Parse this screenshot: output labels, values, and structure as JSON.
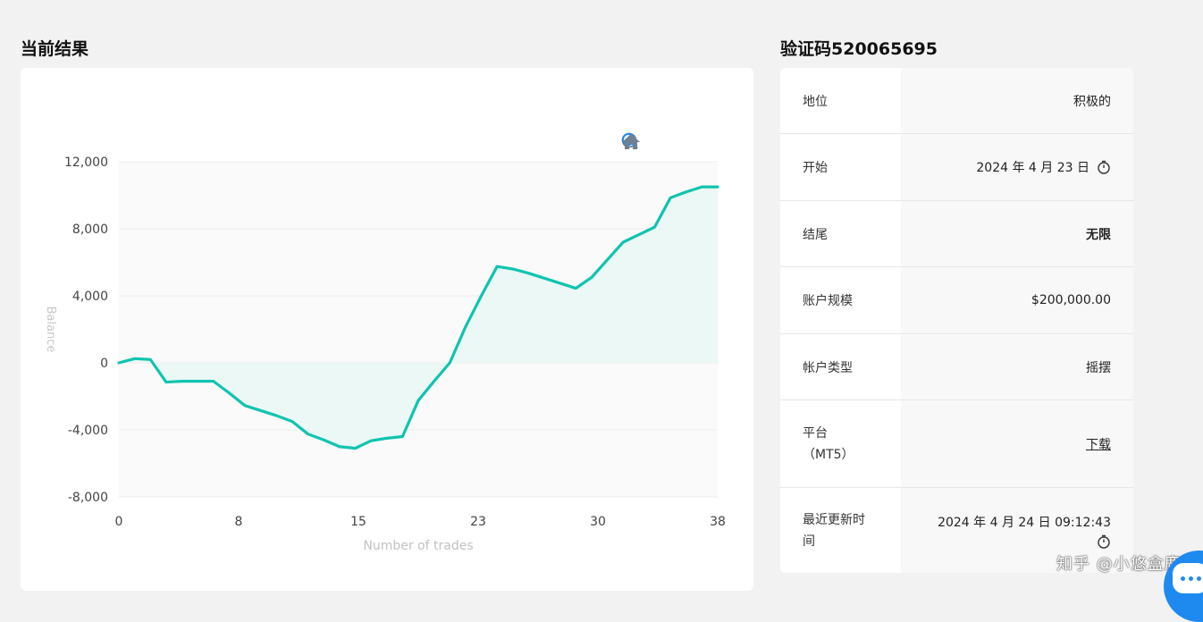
{
  "left_title": "当前结果",
  "right_title": "验证码520065695",
  "toolbar": {
    "zoom_in": "zoom-in-icon",
    "zoom_out": "zoom-out-icon",
    "zoom_select": "magnifier-zoom-icon",
    "reset": "home-icon"
  },
  "colors": {
    "line": "#10c4b0",
    "area": "#e9f7f4",
    "accent_blue": "#1e8af0",
    "toolbar_active": "#1e8af0",
    "toolbar_grey": "#6e8192"
  },
  "chart_data": {
    "type": "area",
    "xlabel": "Number of trades",
    "ylabel": "Balance",
    "xlim": [
      0,
      38
    ],
    "ylim": [
      -8000,
      12000
    ],
    "x_ticks": [
      "0",
      "8",
      "15",
      "23",
      "30",
      "38"
    ],
    "x_tick_values": [
      0,
      7.6,
      15.2,
      22.8,
      30.4,
      38
    ],
    "y_ticks": [
      "12,000",
      "8,000",
      "4,000",
      "0",
      "-4,000",
      "-8,000"
    ],
    "y_tick_values": [
      12000,
      8000,
      4000,
      0,
      -4000,
      -8000
    ],
    "series": [
      {
        "x": [
          0,
          1,
          2,
          3,
          4,
          5,
          6,
          7,
          8,
          9,
          10,
          11,
          12,
          13,
          14,
          15,
          16,
          17,
          18,
          19,
          20,
          21,
          22,
          23,
          24,
          25,
          26,
          27,
          28,
          29,
          30,
          31,
          32,
          33,
          34,
          35,
          36,
          37,
          38
        ],
        "y": [
          0,
          250,
          200,
          -1150,
          -1100,
          -1100,
          -1100,
          -1800,
          -2550,
          -2850,
          -3150,
          -3500,
          -4250,
          -4600,
          -5000,
          -5100,
          -4650,
          -4500,
          -4400,
          -2250,
          -1100,
          0,
          2150,
          4000,
          5750,
          5600,
          5350,
          5050,
          4750,
          4450,
          5100,
          6150,
          7200,
          7650,
          8100,
          9850,
          10200,
          10500,
          10500
        ]
      }
    ]
  },
  "info": [
    {
      "label": "地位",
      "value": "积极的"
    },
    {
      "label": "开始",
      "value": "2024 年 4 月 23 日"
    },
    {
      "label": "结尾",
      "value": "无限"
    },
    {
      "label": "账户规模",
      "value": "$200,000.00"
    },
    {
      "label": "帐户类型",
      "value": "摇摆"
    },
    {
      "label_line1": "平台",
      "label_line2": "（MT5）",
      "value": "下载"
    },
    {
      "label_line1": "最近更新时",
      "label_line2": "间",
      "value": "2024 年 4 月 24 日 09:12:43"
    }
  ],
  "watermark": "知乎 @小悠盒鹿"
}
